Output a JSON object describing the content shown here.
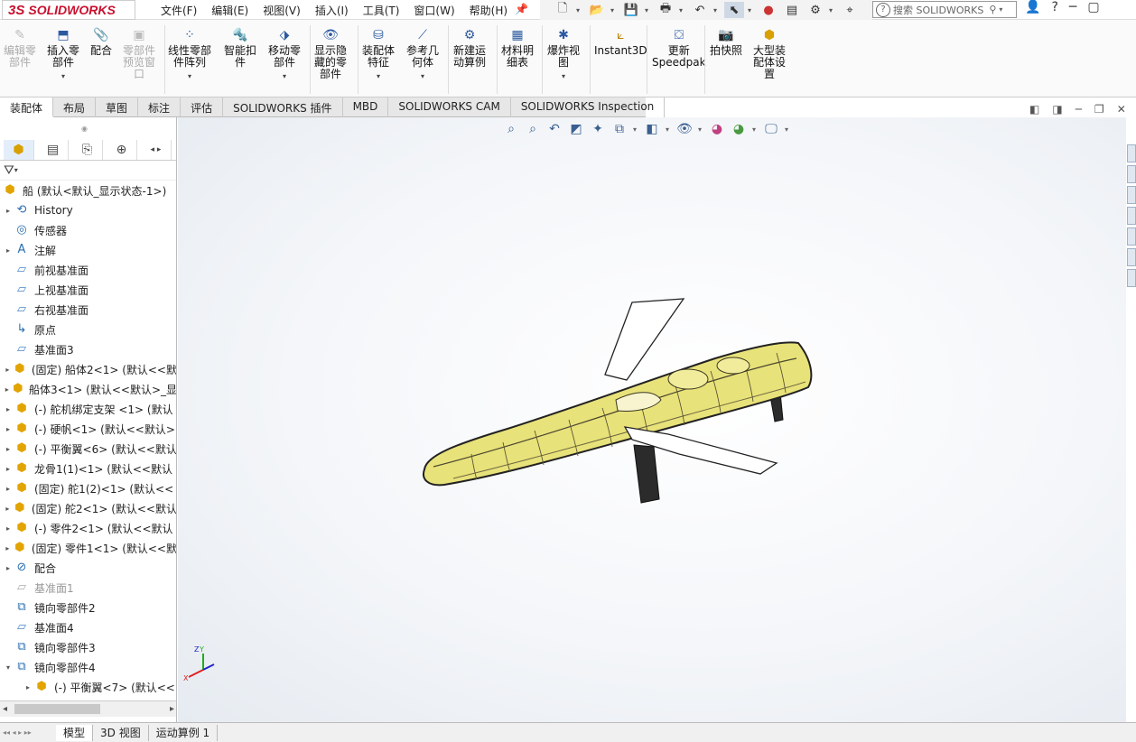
{
  "app": {
    "brand_ds": "3S",
    "brand_name": "SOLIDWORKS"
  },
  "menu": [
    "文件(F)",
    "编辑(E)",
    "视图(V)",
    "插入(I)",
    "工具(T)",
    "窗口(W)",
    "帮助(H)"
  ],
  "search": {
    "placeholder": "搜索 SOLIDWORKS"
  },
  "toolbar": [
    {
      "label": "编辑零\n部件",
      "icon": "edit-component-icon",
      "disabled": true
    },
    {
      "label": "插入零\n部件",
      "icon": "insert-component-icon",
      "caret": true
    },
    {
      "label": "配合",
      "icon": "mate-icon"
    },
    {
      "label": "零部件\n预览窗\n口",
      "icon": "component-preview-icon",
      "disabled": true
    },
    {
      "label": "线性零部\n件阵列",
      "icon": "linear-pattern-icon",
      "caret": true
    },
    {
      "label": "智能扣\n件",
      "icon": "smart-fasteners-icon"
    },
    {
      "label": "移动零\n部件",
      "icon": "move-component-icon",
      "caret": true
    },
    {
      "label": "显示隐\n藏的零\n部件",
      "icon": "show-hidden-icon"
    },
    {
      "label": "装配体\n特征",
      "icon": "assembly-features-icon",
      "caret": true
    },
    {
      "label": "参考几\n何体",
      "icon": "reference-geometry-icon",
      "caret": true
    },
    {
      "label": "新建运\n动算例",
      "icon": "new-motion-study-icon"
    },
    {
      "label": "材料明\n细表",
      "icon": "bom-icon"
    },
    {
      "label": "爆炸视\n图",
      "icon": "exploded-view-icon",
      "caret": true
    },
    {
      "label": "Instant3D",
      "icon": "instant3d-icon"
    },
    {
      "label": "更新\nSpeedpak",
      "icon": "speedpak-icon"
    },
    {
      "label": "拍快照",
      "icon": "snapshot-icon"
    },
    {
      "label": "大型装\n配体设\n置",
      "icon": "large-assembly-icon"
    }
  ],
  "tabs": [
    "装配体",
    "布局",
    "草图",
    "标注",
    "评估",
    "SOLIDWORKS 插件",
    "MBD",
    "SOLIDWORKS CAM",
    "SOLIDWORKS Inspection"
  ],
  "tree": {
    "root": "船 (默认<默认_显示状态-1>)",
    "items": [
      {
        "label": "History",
        "icon": "history-icon",
        "arrow": "▸"
      },
      {
        "label": "传感器",
        "icon": "sensor-icon",
        "arrow": ""
      },
      {
        "label": "注解",
        "icon": "annotation-icon",
        "arrow": "▸"
      },
      {
        "label": "前视基准面",
        "icon": "plane-icon",
        "arrow": ""
      },
      {
        "label": "上视基准面",
        "icon": "plane-icon",
        "arrow": ""
      },
      {
        "label": "右视基准面",
        "icon": "plane-icon",
        "arrow": ""
      },
      {
        "label": "原点",
        "icon": "origin-icon",
        "arrow": ""
      },
      {
        "label": "基准面3",
        "icon": "plane-icon",
        "arrow": ""
      },
      {
        "label": "(固定) 船体2<1> (默认<<默",
        "icon": "part-icon",
        "arrow": "▸"
      },
      {
        "label": "船体3<1> (默认<<默认>_显",
        "icon": "part-icon",
        "arrow": "▸"
      },
      {
        "label": "(-) 舵机绑定支架 <1> (默认",
        "icon": "part-icon",
        "arrow": "▸"
      },
      {
        "label": "(-) 硬帆<1> (默认<<默认>",
        "icon": "part-icon",
        "arrow": "▸"
      },
      {
        "label": "(-) 平衡翼<6> (默认<<默认",
        "icon": "part-icon",
        "arrow": "▸"
      },
      {
        "label": "龙骨1(1)<1> (默认<<默认",
        "icon": "part-icon",
        "arrow": "▸"
      },
      {
        "label": "(固定) 舵1(2)<1> (默认<<",
        "icon": "part-icon",
        "arrow": "▸"
      },
      {
        "label": "(固定) 舵2<1> (默认<<默认",
        "icon": "part-icon",
        "arrow": "▸"
      },
      {
        "label": "(-) 零件2<1> (默认<<默认",
        "icon": "part-icon",
        "arrow": "▸"
      },
      {
        "label": "(固定) 零件1<1> (默认<<默",
        "icon": "part-icon",
        "arrow": "▸"
      },
      {
        "label": "配合",
        "icon": "mates-folder-icon",
        "arrow": "▸"
      },
      {
        "label": "基准面1",
        "icon": "plane-icon",
        "arrow": "",
        "grey": true
      },
      {
        "label": "镜向零部件2",
        "icon": "mirror-component-icon",
        "arrow": ""
      },
      {
        "label": "基准面4",
        "icon": "plane-icon",
        "arrow": ""
      },
      {
        "label": "镜向零部件3",
        "icon": "mirror-component-icon",
        "arrow": ""
      },
      {
        "label": "镜向零部件4",
        "icon": "mirror-component-icon",
        "arrow": "▾"
      },
      {
        "label": "(-) 平衡翼<7> (默认<<",
        "icon": "part-icon",
        "arrow": "▸",
        "indent": true
      }
    ]
  },
  "bottom_tabs": [
    "模型",
    "3D 视图",
    "运动算例 1"
  ],
  "triad": {
    "x": "X",
    "y": "Y",
    "z": "Z"
  },
  "colors": {
    "brand": "#c8102e",
    "hull": "#e8e27a",
    "accent": "#2a6fb0"
  }
}
